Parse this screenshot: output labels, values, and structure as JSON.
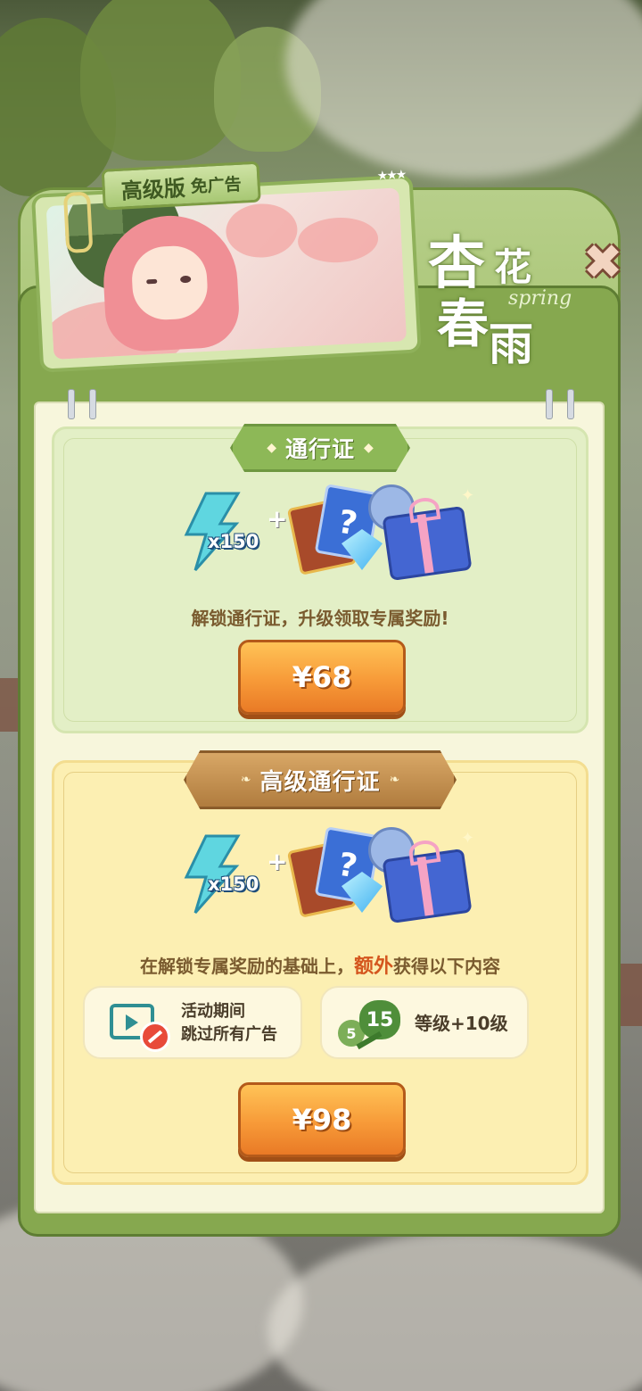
{
  "banner": {
    "tag_main": "高级版",
    "tag_sub": "免广告"
  },
  "title": {
    "char1": "杏",
    "char2": "花",
    "char3": "春",
    "char4": "雨",
    "latin": "spring"
  },
  "close_icon": "close-x-icon",
  "pass_basic": {
    "title": "通行证",
    "energy_qty": "x150",
    "plus": "+",
    "description": "解锁通行证，升级领取专属奖励!",
    "price": "¥68"
  },
  "pass_premium": {
    "title": "高级通行证",
    "energy_qty": "x150",
    "plus": "+",
    "description_prefix": "在解锁专属奖励的基础上，",
    "description_highlight": "额外",
    "description_suffix": "获得以下内容",
    "perk_ads_line1": "活动期间",
    "perk_ads_line2": "跳过所有广告",
    "perk_level_from": "5",
    "perk_level_to": "15",
    "perk_level_text": "等级+10级",
    "price": "¥98"
  },
  "colors": {
    "panel_green": "#86a84f",
    "basic_card": "#e3efc6",
    "premium_card": "#fcefb2",
    "button_orange": "#f79a38",
    "highlight": "#d4561e"
  }
}
